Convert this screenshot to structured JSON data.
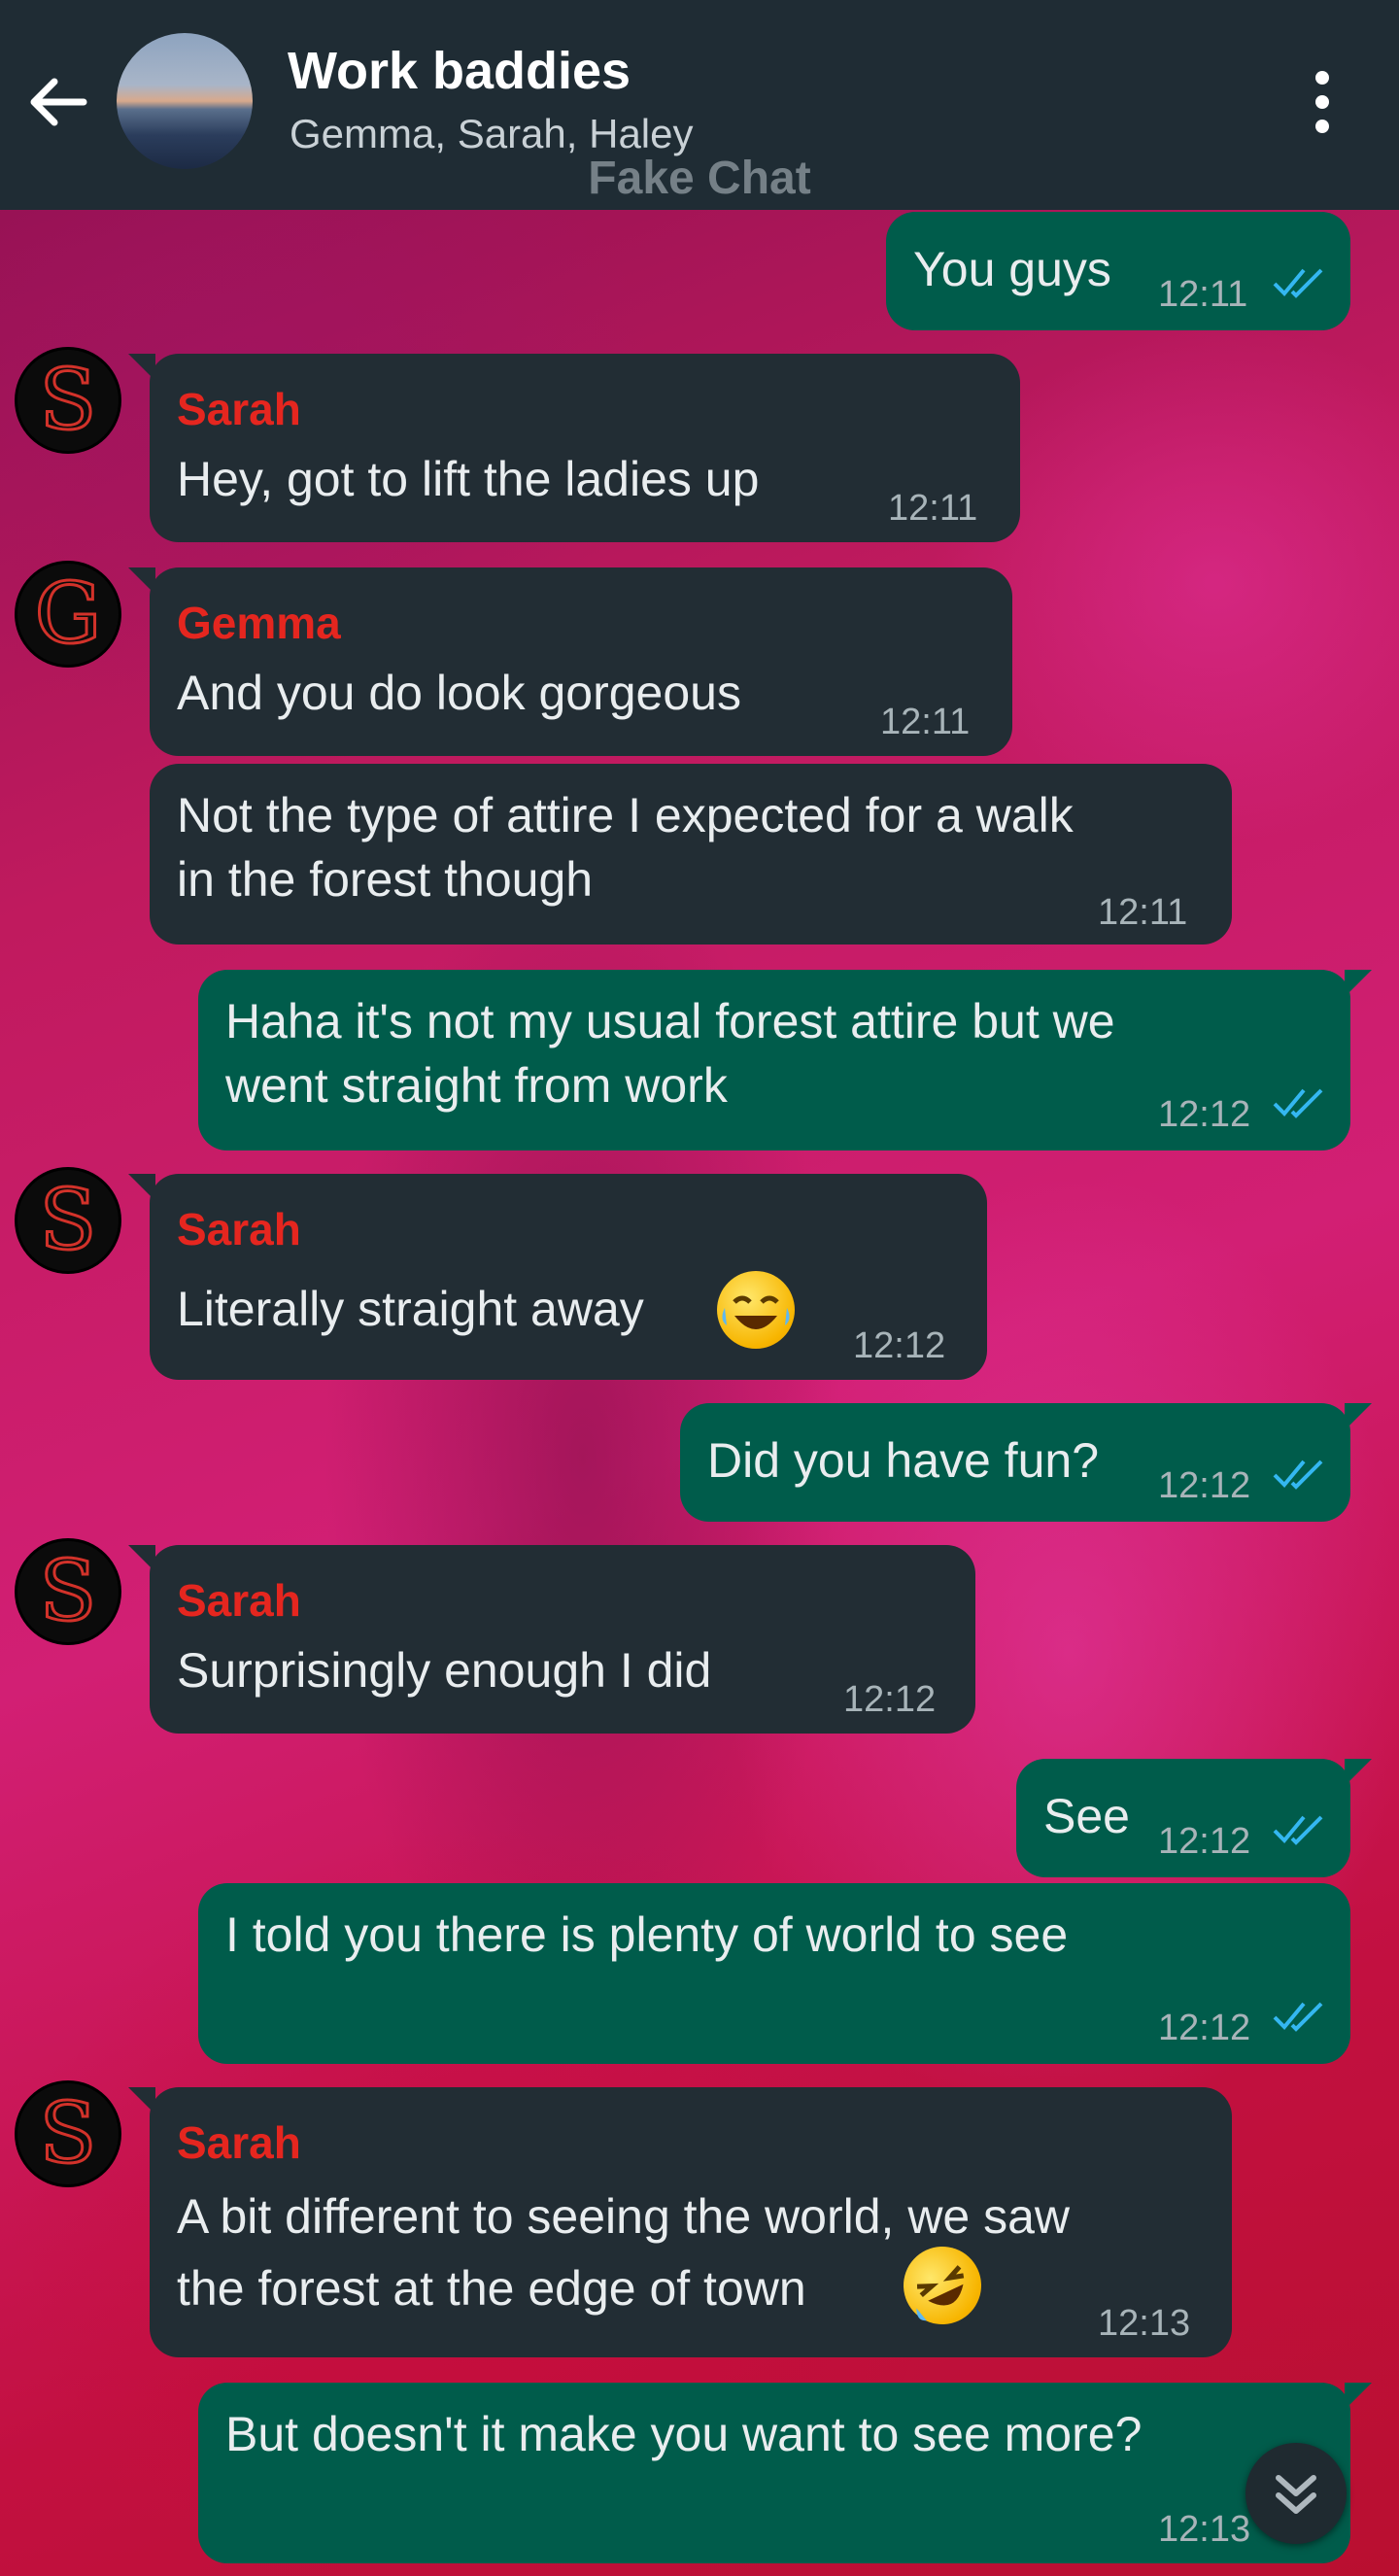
{
  "header": {
    "title": "Work baddies",
    "members": "Gemma, Sarah, Haley",
    "watermark": "Fake Chat",
    "back_icon": "arrow-left-icon",
    "menu_icon": "more-vertical-icon"
  },
  "colors": {
    "header_bg": "#1f2c34",
    "incoming_bubble": "#222d34",
    "outgoing_bubble": "#005c4b",
    "sender_name": "#e5261f",
    "read_ticks": "#34b7f1"
  },
  "messages": [
    {
      "id": "m1",
      "dir": "out",
      "text": "You guys",
      "time": "12:11",
      "read": true
    },
    {
      "id": "m2",
      "dir": "in",
      "sender": "Sarah",
      "avatar": "S",
      "text": "Hey, got to lift the ladies up",
      "time": "12:11"
    },
    {
      "id": "m3",
      "dir": "in",
      "sender": "Gemma",
      "avatar": "G",
      "text": "And you do look gorgeous",
      "time": "12:11"
    },
    {
      "id": "m4",
      "dir": "in",
      "text": "Not the type of attire I expected for a walk\nin the forest though",
      "time": "12:11"
    },
    {
      "id": "m5",
      "dir": "out",
      "text": "Haha it's not my usual forest attire but we\nwent straight from work",
      "time": "12:12",
      "read": true
    },
    {
      "id": "m6",
      "dir": "in",
      "sender": "Sarah",
      "avatar": "S",
      "text": "Literally straight away",
      "emoji": "face-with-tears-of-joy",
      "time": "12:12"
    },
    {
      "id": "m7",
      "dir": "out",
      "text": "Did you have fun?",
      "time": "12:12",
      "read": true
    },
    {
      "id": "m8",
      "dir": "in",
      "sender": "Sarah",
      "avatar": "S",
      "text": "Surprisingly enough I did",
      "time": "12:12"
    },
    {
      "id": "m9",
      "dir": "out",
      "text": "See",
      "time": "12:12",
      "read": true
    },
    {
      "id": "m10",
      "dir": "out",
      "text": "I told you there is plenty of world to see",
      "time": "12:12",
      "read": true
    },
    {
      "id": "m11",
      "dir": "in",
      "sender": "Sarah",
      "avatar": "S",
      "text": "A bit different to seeing the world, we saw\nthe forest at the edge of town",
      "emoji": "rolling-on-the-floor-laughing",
      "time": "12:13"
    },
    {
      "id": "m12",
      "dir": "out",
      "text": "But doesn't it make you want to see more?",
      "time": "12:13",
      "read": true
    }
  ],
  "scroll_button_icon": "double-chevron-down-icon"
}
